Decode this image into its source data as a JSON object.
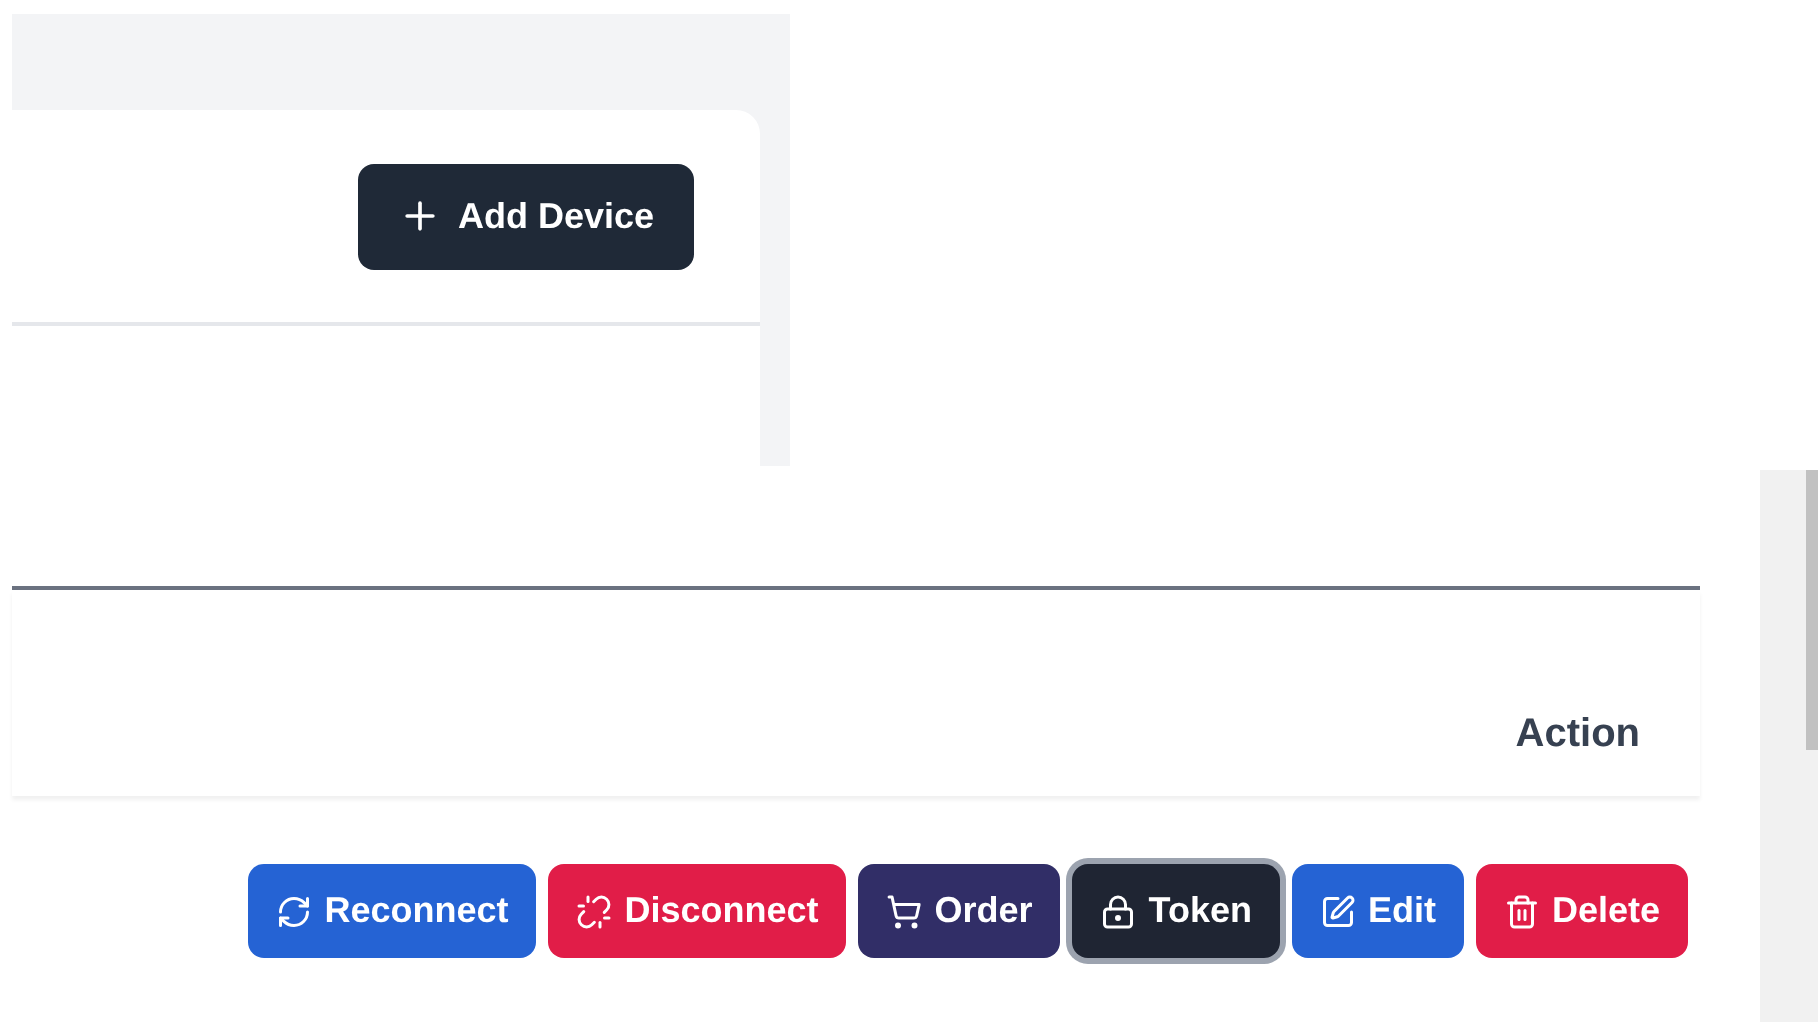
{
  "header": {
    "add_button": {
      "label": "Add Device"
    }
  },
  "table": {
    "columns": [
      {
        "label": "Action"
      }
    ],
    "actions": [
      {
        "label": "Reconnect",
        "kind": "reconnect",
        "focused": false
      },
      {
        "label": "Disconnect",
        "kind": "disconnect",
        "focused": false
      },
      {
        "label": "Order",
        "kind": "order",
        "focused": false
      },
      {
        "label": "Token",
        "kind": "token",
        "focused": true
      },
      {
        "label": "Edit",
        "kind": "edit",
        "focused": false
      },
      {
        "label": "Delete",
        "kind": "delete",
        "focused": false
      }
    ]
  }
}
